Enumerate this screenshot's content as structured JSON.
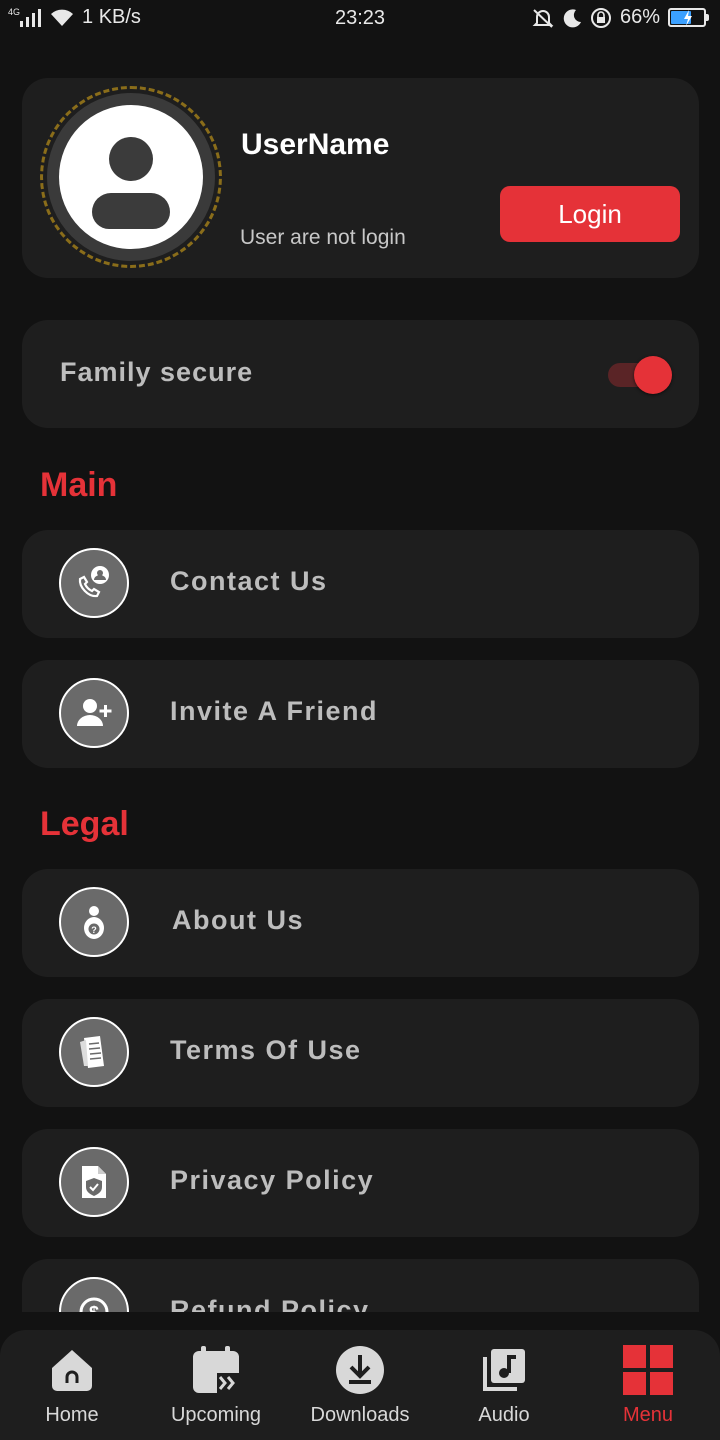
{
  "status_bar": {
    "network_type": "4G",
    "speed": "1 KB/s",
    "time": "23:23",
    "battery_percent": "66%",
    "battery_level": 0.66
  },
  "profile": {
    "username": "UserName",
    "status": "User are not login",
    "login_label": "Login"
  },
  "family_secure": {
    "label": "Family secure",
    "enabled": true
  },
  "sections": {
    "main": {
      "title": "Main",
      "items": [
        {
          "label": "Contact Us",
          "icon": "contact-support-icon"
        },
        {
          "label": "Invite A Friend",
          "icon": "add-user-icon"
        }
      ]
    },
    "legal": {
      "title": "Legal",
      "items": [
        {
          "label": "About Us",
          "icon": "about-person-icon"
        },
        {
          "label": "Terms Of Use",
          "icon": "document-icon"
        },
        {
          "label": "Privacy Policy",
          "icon": "shield-document-icon"
        },
        {
          "label": "Refund Policy",
          "icon": "refund-dollar-icon"
        }
      ]
    }
  },
  "bottom_nav": {
    "items": [
      {
        "label": "Home",
        "icon": "home-icon"
      },
      {
        "label": "Upcoming",
        "icon": "calendar-forward-icon"
      },
      {
        "label": "Downloads",
        "icon": "download-icon"
      },
      {
        "label": "Audio",
        "icon": "music-library-icon"
      },
      {
        "label": "Menu",
        "icon": "grid-menu-icon",
        "active": true
      }
    ]
  },
  "colors": {
    "accent": "#e53238",
    "background": "#121212",
    "card": "#1e1e1e"
  }
}
